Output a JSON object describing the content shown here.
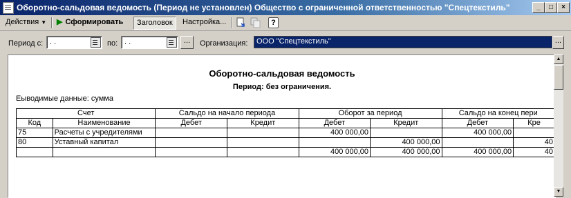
{
  "window": {
    "title": "Оборотно-сальдовая ведомость (Период не установлен) Общество с ограниченной ответственностью  \"Спецтекстиль\"",
    "controls": {
      "minimize": "_",
      "maximize": "□",
      "close": "×"
    }
  },
  "toolbar": {
    "actions_label": "Действия",
    "run_label": "Сформировать",
    "header_label": "Заголовок",
    "settings_label": "Настройка...",
    "help_label": "?"
  },
  "params": {
    "period_from_label": "Период с:",
    "period_from_value": ". .",
    "period_to_label": "по:",
    "period_to_value": ". .",
    "select_button": "...",
    "org_label": "Организация:",
    "org_value": "ООО \"Спецтекстиль\"",
    "org_button": "..."
  },
  "report": {
    "title": "Оборотно-сальдовая ведомость",
    "period": "Период: без ограничения.",
    "output": "Еыводимые данные: сумма",
    "header_groups": [
      "Счет",
      "Сальдо на начало периода",
      "Оборот за период",
      "Сальдо на конец пери"
    ],
    "header_cols": [
      "Код",
      "Наименование",
      "Дебет",
      "Кредит",
      "Дебет",
      "Кредит",
      "Дебет",
      "Кре"
    ],
    "rows": [
      [
        "75",
        "Расчеты с учредителями",
        "",
        "",
        "400 000,00",
        "",
        "400 000,00",
        ""
      ],
      [
        "80",
        "Уставный капитал",
        "",
        "",
        "",
        "400 000,00",
        "",
        "40"
      ]
    ],
    "totals": [
      "",
      "",
      "",
      "",
      "400 000,00",
      "400 000,00",
      "400 000,00",
      "40"
    ]
  },
  "colors": {
    "titlebar": "#0a246a",
    "chrome": "#d4d0c8",
    "selection": "#0a246a",
    "run_icon": "#008000"
  }
}
